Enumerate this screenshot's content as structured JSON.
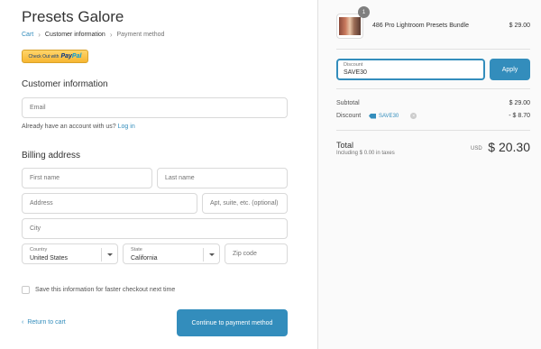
{
  "store": {
    "title": "Presets Galore"
  },
  "breadcrumb": {
    "cart": "Cart",
    "customer": "Customer information",
    "payment": "Payment method",
    "sep": "›"
  },
  "paypal": {
    "prefix": "Check Out with",
    "brand_pay": "Pay",
    "brand_pal": "Pal"
  },
  "customer_section": {
    "title": "Customer information",
    "email_placeholder": "Email",
    "already_text": "Already have an account with us?",
    "login_link": "Log in"
  },
  "billing_section": {
    "title": "Billing address",
    "first_name_placeholder": "First name",
    "last_name_placeholder": "Last name",
    "address_placeholder": "Address",
    "apt_placeholder": "Apt, suite, etc. (optional)",
    "city_placeholder": "City",
    "country_label": "Country",
    "country_value": "United States",
    "state_label": "State",
    "state_value": "California",
    "zip_placeholder": "Zip code"
  },
  "save_info": {
    "label": "Save this information for faster checkout next time"
  },
  "nav": {
    "return_label": "Return to cart",
    "return_icon": "‹",
    "continue_label": "Continue to payment method"
  },
  "order": {
    "quantity": "1",
    "product_name": "486 Pro Lightroom Presets Bundle",
    "product_price": "$ 29.00"
  },
  "discount": {
    "label": "Discount",
    "value": "SAVE30",
    "apply_label": "Apply"
  },
  "summary": {
    "subtotal_label": "Subtotal",
    "subtotal_value": "$ 29.00",
    "discount_label": "Discount",
    "discount_code": "SAVE30",
    "discount_value": "- $ 8.70",
    "remove_icon": "×",
    "total_label": "Total",
    "taxes_text": "Including $ 0.00 in taxes",
    "currency": "USD",
    "total_value": "$ 20.30"
  },
  "colors": {
    "accent": "#338dbc",
    "sidebar_bg": "#fafafa"
  }
}
